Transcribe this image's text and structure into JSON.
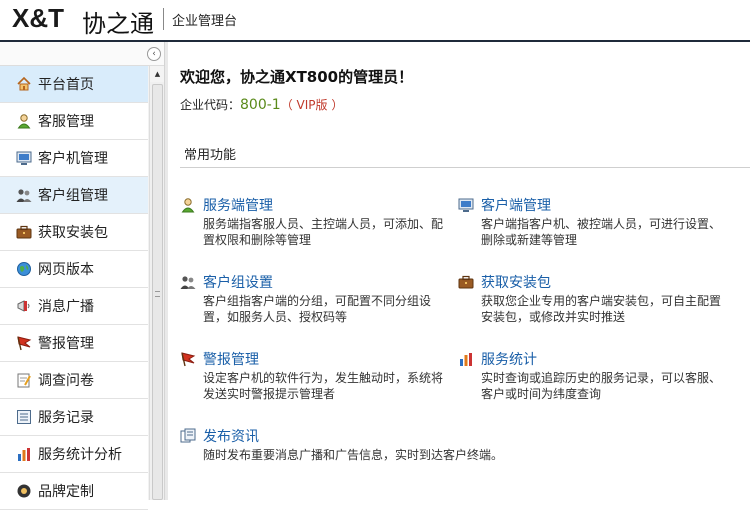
{
  "header": {
    "logo_text": "X&T",
    "logo_cn": "协之通",
    "subtitle": "企业管理台"
  },
  "sidebar": {
    "collapse_glyph": "‹",
    "items": [
      {
        "label": "平台首页",
        "icon": "home-icon"
      },
      {
        "label": "客服管理",
        "icon": "user-icon"
      },
      {
        "label": "客户机管理",
        "icon": "monitor-icon"
      },
      {
        "label": "客户组管理",
        "icon": "group-icon"
      },
      {
        "label": "获取安装包",
        "icon": "briefcase-icon"
      },
      {
        "label": "网页版本",
        "icon": "globe-icon"
      },
      {
        "label": "消息广播",
        "icon": "megaphone-icon"
      },
      {
        "label": "警报管理",
        "icon": "flag-icon"
      },
      {
        "label": "调查问卷",
        "icon": "survey-icon"
      },
      {
        "label": "服务记录",
        "icon": "list-icon"
      },
      {
        "label": "服务统计分析",
        "icon": "bar-chart-icon"
      },
      {
        "label": "品牌定制",
        "icon": "brand-icon"
      }
    ]
  },
  "main": {
    "welcome": "欢迎您，协之通XT800的管理员！",
    "company_label": "企业代码：",
    "company_code": "800-1",
    "vip_text": "（ VIP版 ）",
    "section_title": "常用功能",
    "features": [
      {
        "title": "服务端管理",
        "desc": "服务端指客服人员、主控端人员，可添加、配置权限和删除等管理",
        "icon": "user-icon"
      },
      {
        "title": "客户端管理",
        "desc": "客户端指客户机、被控端人员，可进行设置、删除或新建等管理",
        "icon": "monitor-icon"
      },
      {
        "title": "客户组设置",
        "desc": "客户组指客户端的分组，可配置不同分组设置，如服务人员、授权码等",
        "icon": "group-icon"
      },
      {
        "title": "获取安装包",
        "desc": "获取您企业专用的客户端安装包，可自主配置安装包，或修改并实时推送",
        "icon": "briefcase-icon"
      },
      {
        "title": "警报管理",
        "desc": "设定客户机的软件行为，发生触动时，系统将发送实时警报提示管理者",
        "icon": "flag-icon"
      },
      {
        "title": "服务统计",
        "desc": "实时查询或追踪历史的服务记录，可以客服、客户或时间为纬度查询",
        "icon": "bar-chart-icon"
      },
      {
        "title": "发布资讯",
        "desc": "随时发布重要消息广播和广告信息，实时到达客户终端。",
        "icon": "news-icon"
      }
    ]
  },
  "colors": {
    "link": "#1a5fa8",
    "code": "#5a8a1a",
    "vip": "#c0392b",
    "active_nav": "#d9ecfb"
  }
}
